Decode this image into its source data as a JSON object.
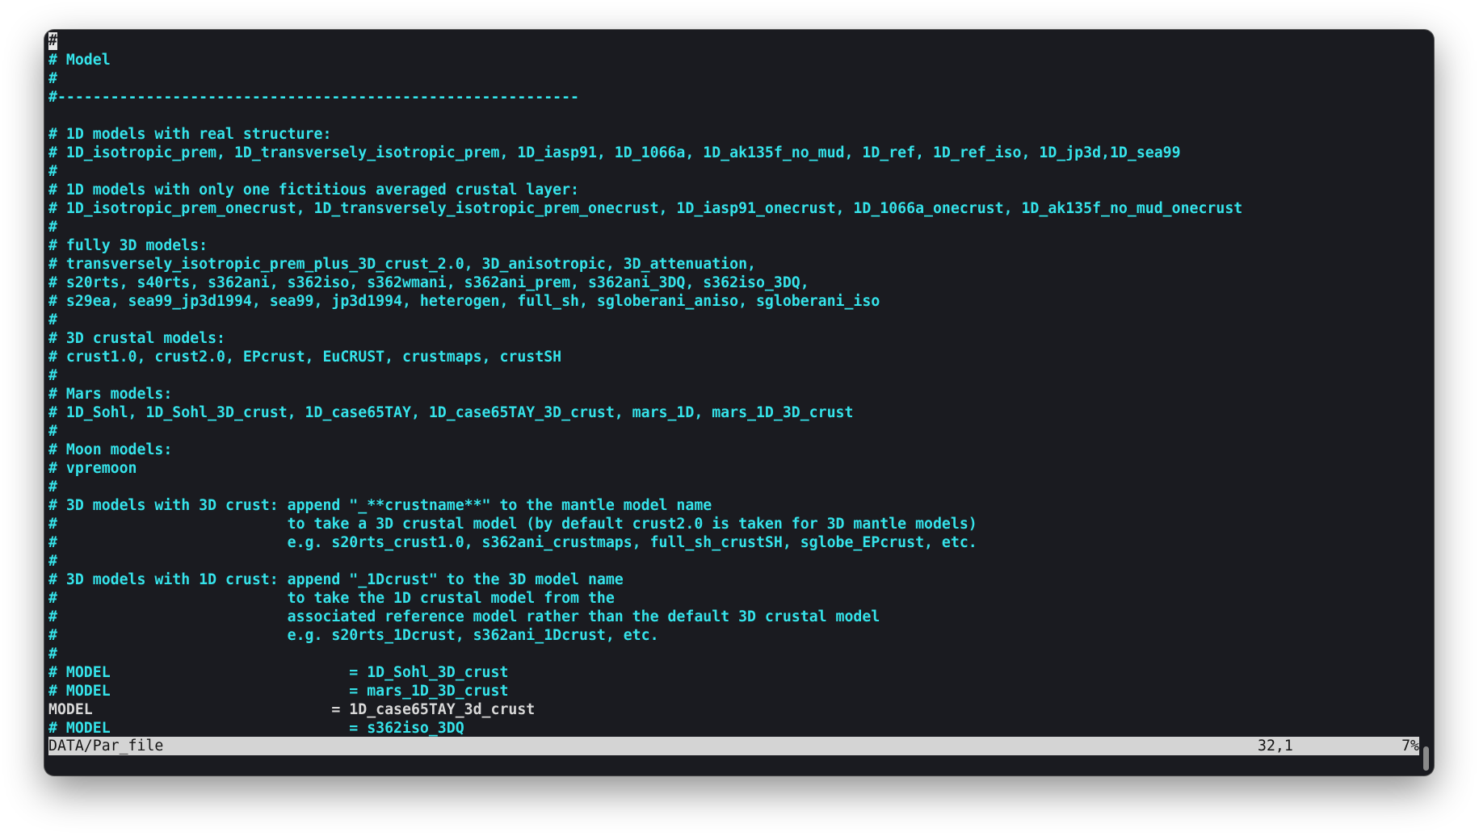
{
  "editor": {
    "cursor_char": "#",
    "lines": [
      {
        "text": "",
        "kind": "comment",
        "cursor": true
      },
      {
        "text": "# Model",
        "kind": "comment"
      },
      {
        "text": "#",
        "kind": "comment"
      },
      {
        "text": "#-----------------------------------------------------------",
        "kind": "comment"
      },
      {
        "text": "",
        "kind": "comment"
      },
      {
        "text": "# 1D models with real structure:",
        "kind": "comment"
      },
      {
        "text": "# 1D_isotropic_prem, 1D_transversely_isotropic_prem, 1D_iasp91, 1D_1066a, 1D_ak135f_no_mud, 1D_ref, 1D_ref_iso, 1D_jp3d,1D_sea99",
        "kind": "comment"
      },
      {
        "text": "#",
        "kind": "comment"
      },
      {
        "text": "# 1D models with only one fictitious averaged crustal layer:",
        "kind": "comment"
      },
      {
        "text": "# 1D_isotropic_prem_onecrust, 1D_transversely_isotropic_prem_onecrust, 1D_iasp91_onecrust, 1D_1066a_onecrust, 1D_ak135f_no_mud_onecrust",
        "kind": "comment"
      },
      {
        "text": "#",
        "kind": "comment"
      },
      {
        "text": "# fully 3D models:",
        "kind": "comment"
      },
      {
        "text": "# transversely_isotropic_prem_plus_3D_crust_2.0, 3D_anisotropic, 3D_attenuation,",
        "kind": "comment"
      },
      {
        "text": "# s20rts, s40rts, s362ani, s362iso, s362wmani, s362ani_prem, s362ani_3DQ, s362iso_3DQ,",
        "kind": "comment"
      },
      {
        "text": "# s29ea, sea99_jp3d1994, sea99, jp3d1994, heterogen, full_sh, sgloberani_aniso, sgloberani_iso",
        "kind": "comment"
      },
      {
        "text": "#",
        "kind": "comment"
      },
      {
        "text": "# 3D crustal models:",
        "kind": "comment"
      },
      {
        "text": "# crust1.0, crust2.0, EPcrust, EuCRUST, crustmaps, crustSH",
        "kind": "comment"
      },
      {
        "text": "#",
        "kind": "comment"
      },
      {
        "text": "# Mars models:",
        "kind": "comment"
      },
      {
        "text": "# 1D_Sohl, 1D_Sohl_3D_crust, 1D_case65TAY, 1D_case65TAY_3D_crust, mars_1D, mars_1D_3D_crust",
        "kind": "comment"
      },
      {
        "text": "#",
        "kind": "comment"
      },
      {
        "text": "# Moon models:",
        "kind": "comment"
      },
      {
        "text": "# vpremoon",
        "kind": "comment"
      },
      {
        "text": "#",
        "kind": "comment"
      },
      {
        "text": "# 3D models with 3D crust: append \"_**crustname**\" to the mantle model name",
        "kind": "comment"
      },
      {
        "text": "#                          to take a 3D crustal model (by default crust2.0 is taken for 3D mantle models)",
        "kind": "comment"
      },
      {
        "text": "#                          e.g. s20rts_crust1.0, s362ani_crustmaps, full_sh_crustSH, sglobe_EPcrust, etc.",
        "kind": "comment"
      },
      {
        "text": "#",
        "kind": "comment"
      },
      {
        "text": "# 3D models with 1D crust: append \"_1Dcrust\" to the 3D model name",
        "kind": "comment"
      },
      {
        "text": "#                          to take the 1D crustal model from the",
        "kind": "comment"
      },
      {
        "text": "#                          associated reference model rather than the default 3D crustal model",
        "kind": "comment"
      },
      {
        "text": "#                          e.g. s20rts_1Dcrust, s362ani_1Dcrust, etc.",
        "kind": "comment"
      },
      {
        "text": "#",
        "kind": "comment"
      },
      {
        "text": "# MODEL                           = 1D_Sohl_3D_crust",
        "kind": "comment"
      },
      {
        "text": "# MODEL                           = mars_1D_3D_crust",
        "kind": "comment"
      },
      {
        "text": "MODEL                           = 1D_case65TAY_3d_crust",
        "kind": "code"
      },
      {
        "text": "# MODEL                           = s362iso_3DQ",
        "kind": "comment"
      }
    ]
  },
  "statusbar": {
    "filename": "DATA/Par_file",
    "position": "32,1",
    "percent": "7%"
  },
  "colors": {
    "comment": "#35e3ea",
    "code": "#d8d8d8",
    "background": "#1a1b20",
    "statusbar_bg": "#d4d4d4"
  }
}
